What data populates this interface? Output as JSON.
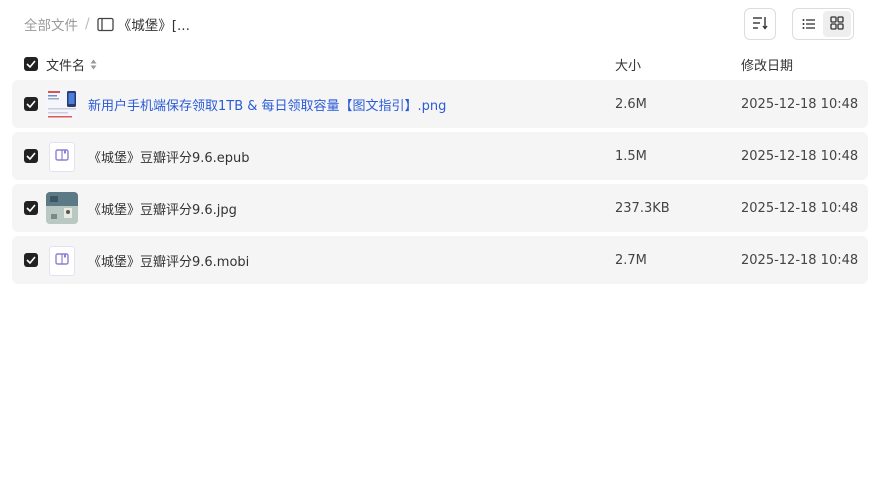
{
  "breadcrumb": {
    "root": "全部文件",
    "separator": "/",
    "current": "《城堡》[..."
  },
  "toolbar": {
    "sort_icon": "sort-list-icon",
    "list_view_icon": "list-view-icon",
    "grid_view_icon": "grid-view-icon",
    "active_view": "grid"
  },
  "table": {
    "columns": {
      "name": "文件名",
      "size": "大小",
      "date": "修改日期"
    },
    "rows": [
      {
        "name": "新用户手机端保存领取1TB & 每日领取容量【图文指引】.png",
        "size": "2.6M",
        "date": "2025-12-18 10:48",
        "type": "image",
        "icon": "promo-image-thumbnail",
        "checked": true,
        "link": true
      },
      {
        "name": "《城堡》豆瓣评分9.6.epub",
        "size": "1.5M",
        "date": "2025-12-18 10:48",
        "type": "ebook",
        "icon": "book-icon",
        "checked": true,
        "link": false
      },
      {
        "name": "《城堡》豆瓣评分9.6.jpg",
        "size": "237.3KB",
        "date": "2025-12-18 10:48",
        "type": "image",
        "icon": "cover-image-thumbnail",
        "checked": true,
        "link": false
      },
      {
        "name": "《城堡》豆瓣评分9.6.mobi",
        "size": "2.7M",
        "date": "2025-12-18 10:48",
        "type": "ebook",
        "icon": "book-icon",
        "checked": true,
        "link": false
      }
    ]
  },
  "colors": {
    "link": "#2a5bd7",
    "row_bg": "#f5f5f5",
    "book_icon": "#8b7fd6"
  }
}
